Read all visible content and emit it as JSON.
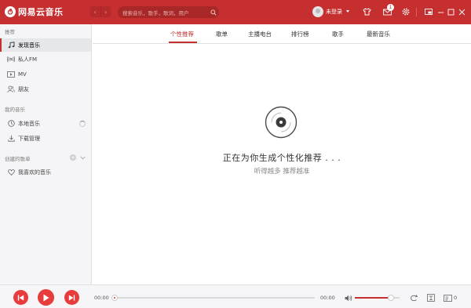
{
  "colors": {
    "accent": "#c62f2f",
    "play_button": "#e83c3c",
    "sidebar_bg": "#f5f5f7"
  },
  "app": {
    "name": "网易云音乐",
    "logo_icon": "netease-logo-icon"
  },
  "titlebar": {
    "back": "‹",
    "forward": "›",
    "search_placeholder": "搜索音乐，歌手，歌词，用户",
    "login_label": "未登录",
    "message_count": "1",
    "icons": [
      "back-icon",
      "forward-icon",
      "search-icon",
      "skin-icon",
      "message-icon",
      "settings-icon",
      "mini-mode-icon",
      "minimize-icon",
      "maximize-icon",
      "close-icon"
    ]
  },
  "sidebar": {
    "sections": [
      {
        "title": "推荐",
        "items": [
          {
            "label": "发现音乐",
            "icon": "music-note-icon",
            "active": true
          },
          {
            "label": "私人FM",
            "icon": "radio-icon",
            "active": false
          },
          {
            "label": "MV",
            "icon": "video-icon",
            "active": false
          },
          {
            "label": "朋友",
            "icon": "friends-icon",
            "active": false
          }
        ]
      },
      {
        "title": "我的音乐",
        "items": [
          {
            "label": "本地音乐",
            "icon": "local-music-icon",
            "active": false
          },
          {
            "label": "下载管理",
            "icon": "download-icon",
            "active": false
          }
        ]
      },
      {
        "title": "创建的歌单",
        "items": [
          {
            "label": "我喜欢的音乐",
            "icon": "heart-icon",
            "active": false
          }
        ]
      }
    ],
    "add_symbol": "+"
  },
  "main": {
    "tabs": [
      {
        "label": "个性推荐",
        "active": true
      },
      {
        "label": "歌单",
        "active": false
      },
      {
        "label": "主播电台",
        "active": false
      },
      {
        "label": "排行榜",
        "active": false
      },
      {
        "label": "歌手",
        "active": false
      },
      {
        "label": "最新音乐",
        "active": false
      }
    ],
    "loading_title": "正在为你生成个性化推荐 . . .",
    "loading_subtitle": "听得越多 推荐越准",
    "loading_icon": "disc-icon"
  },
  "player": {
    "current_time": "00:00",
    "total_time": "00:00",
    "progress": 0,
    "volume": 0.8,
    "playlist_count": "0",
    "icons": [
      "prev-icon",
      "play-icon",
      "next-icon",
      "volume-icon",
      "loop-icon",
      "lyrics-icon",
      "playlist-icon"
    ]
  }
}
